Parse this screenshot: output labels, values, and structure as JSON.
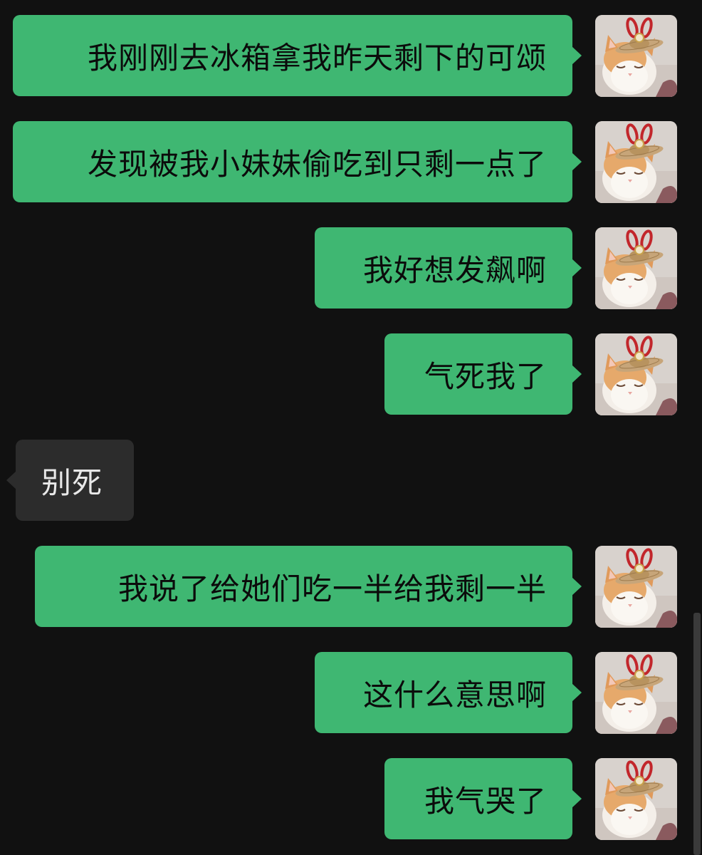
{
  "conversation": {
    "messages": [
      {
        "sender": "me",
        "text": "我刚刚去冰箱拿我昨天剩下的可颂"
      },
      {
        "sender": "me",
        "text": "发现被我小妹妹偷吃到只剩一点了"
      },
      {
        "sender": "me",
        "text": "我好想发飙啊"
      },
      {
        "sender": "me",
        "text": "气死我了"
      },
      {
        "sender": "them",
        "text": "别死"
      },
      {
        "sender": "me",
        "text": "我说了给她们吃一半给我剩一半"
      },
      {
        "sender": "me",
        "text": "这什么意思啊"
      },
      {
        "sender": "me",
        "text": "我气哭了"
      }
    ]
  },
  "avatar": {
    "icon": "cat-with-bunny-ear-hat-icon"
  },
  "colors": {
    "background": "#111111",
    "my_bubble": "#3fb772",
    "their_bubble": "#2c2c2c"
  }
}
